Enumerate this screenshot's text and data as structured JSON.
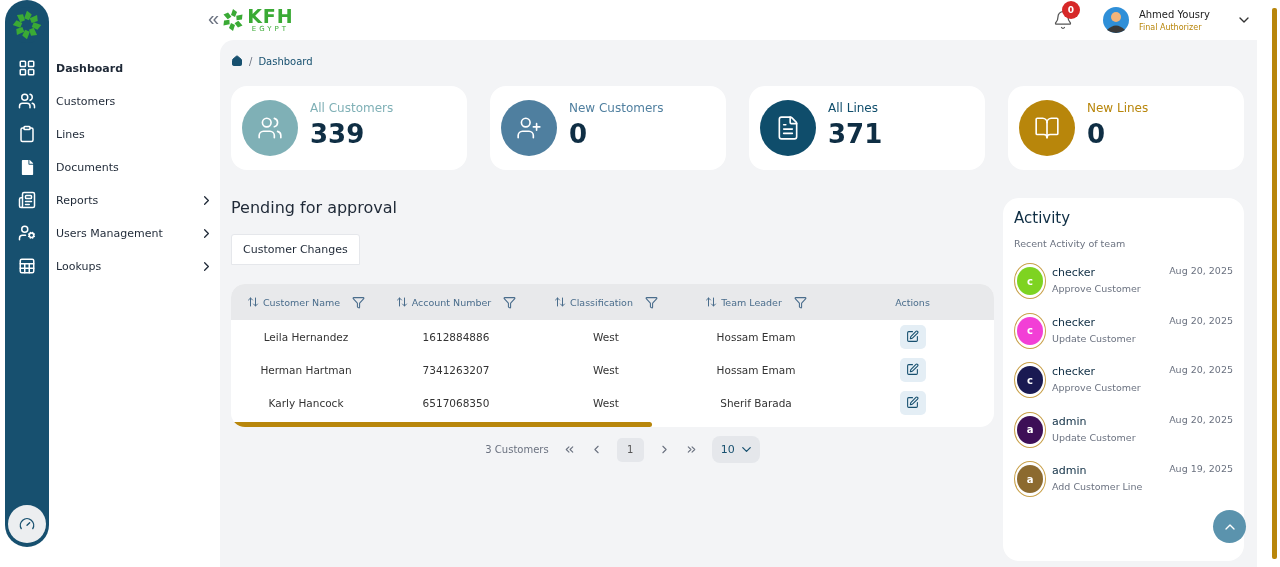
{
  "header": {
    "collapse": "«",
    "logo": {
      "name": "KFH",
      "sub": "EGYPT"
    },
    "notifications": "0",
    "user": {
      "name": "Ahmed Yousry",
      "role": "Final Authorizer"
    }
  },
  "sidebar": {
    "items": [
      {
        "label": "Dashboard",
        "selected": true,
        "has_children": false
      },
      {
        "label": "Customers",
        "selected": false,
        "has_children": false
      },
      {
        "label": "Lines",
        "selected": false,
        "has_children": false
      },
      {
        "label": "Documents",
        "selected": false,
        "has_children": false
      },
      {
        "label": "Reports",
        "selected": false,
        "has_children": true
      },
      {
        "label": "Users Management",
        "selected": false,
        "has_children": true
      },
      {
        "label": "Lookups",
        "selected": false,
        "has_children": true
      }
    ]
  },
  "breadcrumb": {
    "separator": "/",
    "current": "Dashboard"
  },
  "stats": [
    {
      "label": "All Customers",
      "value": "339",
      "color": "#7fb0b6"
    },
    {
      "label": "New Customers",
      "value": "0",
      "color": "#4f7f9f"
    },
    {
      "label": "All Lines",
      "value": "371",
      "color": "#0f4d6b"
    },
    {
      "label": "New Lines",
      "value": "0",
      "color": "#b8860b"
    }
  ],
  "pending": {
    "title": "Pending for approval",
    "tabs": [
      {
        "label": "Customer Changes",
        "selected": true
      }
    ],
    "table": {
      "columns": [
        {
          "label": "Customer Name",
          "sortable": true,
          "filterable": true
        },
        {
          "label": "Account Number",
          "sortable": true,
          "filterable": true
        },
        {
          "label": "Classification",
          "sortable": true,
          "filterable": true
        },
        {
          "label": "Team Leader",
          "sortable": true,
          "filterable": true
        },
        {
          "label": "Actions",
          "sortable": false,
          "filterable": false
        }
      ],
      "rows": [
        [
          "Leila Hernandez",
          "1612884886",
          "West",
          "Hossam Emam"
        ],
        [
          "Herman Hartman",
          "7341263207",
          "West",
          "Hossam Emam"
        ],
        [
          "Karly Hancock",
          "6517068350",
          "West",
          "Sherif Barada"
        ]
      ]
    },
    "pagination": {
      "count": "3 Customers",
      "page": "1",
      "page_size": "10"
    }
  },
  "activity": {
    "title": "Activity",
    "subtitle": "Recent Activity of team",
    "items": [
      {
        "initial": "c",
        "color": "#7ed321",
        "name": "checker",
        "action": "Approve Customer",
        "date": "Aug 20, 2025"
      },
      {
        "initial": "c",
        "color": "#f23fd6",
        "name": "checker",
        "action": "Update Customer",
        "date": "Aug 20, 2025"
      },
      {
        "initial": "c",
        "color": "#1a1a52",
        "name": "checker",
        "action": "Approve Customer",
        "date": "Aug 20, 2025"
      },
      {
        "initial": "a",
        "color": "#3d0f57",
        "name": "admin",
        "action": "Update Customer",
        "date": "Aug 20, 2025"
      },
      {
        "initial": "a",
        "color": "#8c6a2f",
        "name": "admin",
        "action": "Add Customer Line",
        "date": "Aug 19, 2025"
      }
    ]
  }
}
